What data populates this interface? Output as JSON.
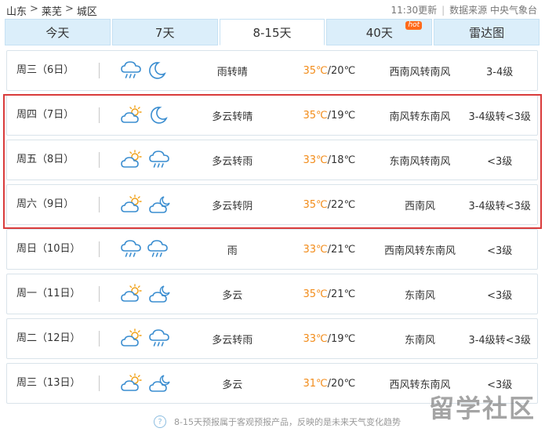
{
  "breadcrumb": {
    "province": "山东",
    "city": "莱芜",
    "district": "城区",
    "sep": ">"
  },
  "meta": {
    "updated": "11:30更新",
    "source": "数据来源 中央气象台"
  },
  "tabs": [
    {
      "label": "今天"
    },
    {
      "label": "7天"
    },
    {
      "label": "8-15天",
      "active": true
    },
    {
      "label": "40天",
      "badge": "hot"
    },
    {
      "label": "雷达图"
    }
  ],
  "rows": [
    {
      "day": "周三（6日）",
      "icons": [
        "rain-cloud",
        "moon"
      ],
      "cond": "雨转晴",
      "hi": "35℃",
      "lo": "/20℃",
      "wind": "西南风转南风",
      "level": "3-4级"
    },
    {
      "day": "周四（7日）",
      "icons": [
        "partly-cloudy",
        "moon"
      ],
      "cond": "多云转晴",
      "hi": "35℃",
      "lo": "/19℃",
      "wind": "南风转东南风",
      "level": "3-4级转<3级"
    },
    {
      "day": "周五（8日）",
      "icons": [
        "partly-cloudy",
        "rain-cloud"
      ],
      "cond": "多云转雨",
      "hi": "33℃",
      "lo": "/18℃",
      "wind": "东南风转南风",
      "level": "<3级"
    },
    {
      "day": "周六（9日）",
      "icons": [
        "partly-cloudy",
        "cloudy-night"
      ],
      "cond": "多云转阴",
      "hi": "35℃",
      "lo": "/22℃",
      "wind": "西南风",
      "level": "3-4级转<3级"
    },
    {
      "day": "周日（10日）",
      "icons": [
        "rain-cloud",
        "rain-cloud"
      ],
      "cond": "雨",
      "hi": "33℃",
      "lo": "/21℃",
      "wind": "西南风转东南风",
      "level": "<3级"
    },
    {
      "day": "周一（11日）",
      "icons": [
        "partly-cloudy",
        "cloudy-night"
      ],
      "cond": "多云",
      "hi": "35℃",
      "lo": "/21℃",
      "wind": "东南风",
      "level": "<3级"
    },
    {
      "day": "周二（12日）",
      "icons": [
        "partly-cloudy",
        "rain-cloud"
      ],
      "cond": "多云转雨",
      "hi": "33℃",
      "lo": "/19℃",
      "wind": "东南风",
      "level": "3-4级转<3级"
    },
    {
      "day": "周三（13日）",
      "icons": [
        "partly-cloudy",
        "cloudy-night"
      ],
      "cond": "多云",
      "hi": "31℃",
      "lo": "/20℃",
      "wind": "西风转东南风",
      "level": "<3级"
    }
  ],
  "footnote": "8-15天预报属于客观预报产品，反映的是未来天气变化趋势",
  "watermark": "留学社区",
  "colors": {
    "accent": "#f28c1a",
    "tab_bg": "#dbeefa",
    "highlight": "#d93b3b"
  }
}
